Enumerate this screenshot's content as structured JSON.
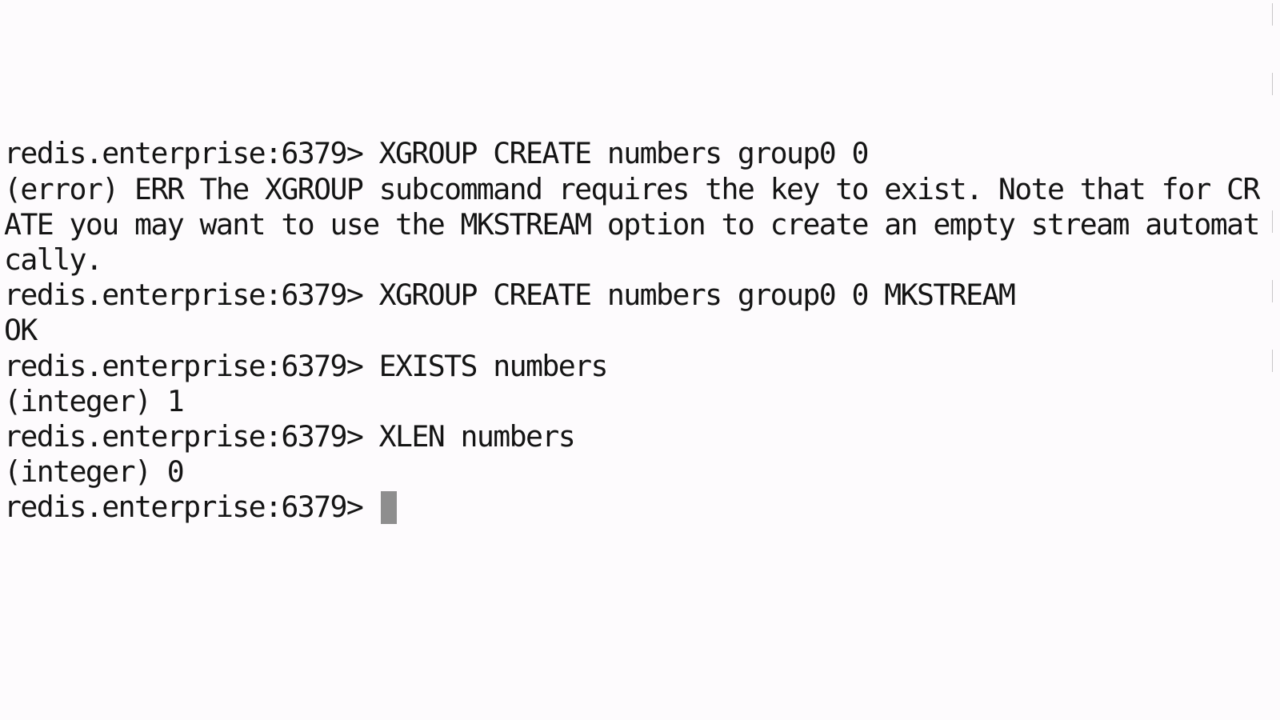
{
  "terminal": {
    "prompt": "redis.enterprise:6379> ",
    "lines": [
      {
        "kind": "prompt",
        "text": "redis.enterprise:6379> XGROUP CREATE numbers group0 0"
      },
      {
        "kind": "output",
        "text": "(error) ERR The XGROUP subcommand requires the key to exist. Note that for CRE"
      },
      {
        "kind": "output",
        "text": "ATE you may want to use the MKSTREAM option to create an empty stream automati"
      },
      {
        "kind": "output",
        "text": "cally."
      },
      {
        "kind": "prompt",
        "text": "redis.enterprise:6379> XGROUP CREATE numbers group0 0 MKSTREAM"
      },
      {
        "kind": "output",
        "text": "OK"
      },
      {
        "kind": "prompt",
        "text": "redis.enterprise:6379> EXISTS numbers"
      },
      {
        "kind": "output",
        "text": "(integer) 1"
      },
      {
        "kind": "prompt",
        "text": "redis.enterprise:6379> XLEN numbers"
      },
      {
        "kind": "output",
        "text": "(integer) 0"
      }
    ],
    "current_input": "",
    "colors": {
      "background": "#fdfbfd",
      "text": "#141414",
      "cursor": "#8e8e8e"
    }
  }
}
